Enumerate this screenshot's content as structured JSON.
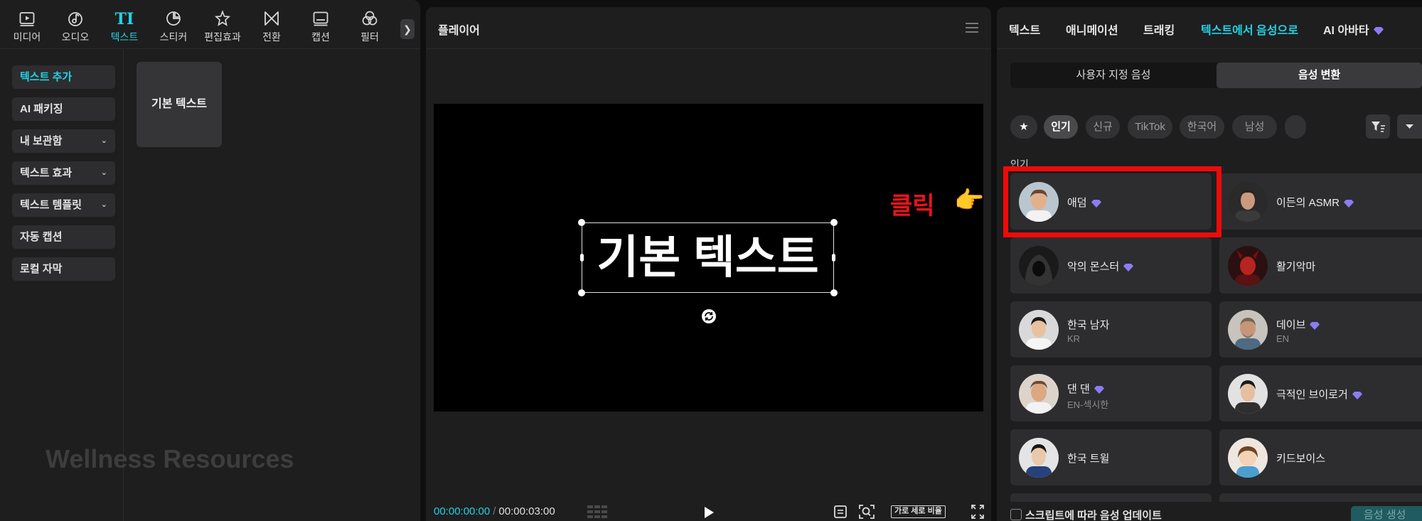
{
  "toolbar": {
    "items": [
      {
        "label": "미디어",
        "icon": "media-icon"
      },
      {
        "label": "오디오",
        "icon": "audio-icon"
      },
      {
        "label": "텍스트",
        "icon": "text-icon",
        "glyph": "TI"
      },
      {
        "label": "스티커",
        "icon": "sticker-icon"
      },
      {
        "label": "편집효과",
        "icon": "effects-icon"
      },
      {
        "label": "전환",
        "icon": "transition-icon"
      },
      {
        "label": "캡션",
        "icon": "caption-icon"
      },
      {
        "label": "필터",
        "icon": "filter-icon"
      }
    ],
    "more_glyph": "❯"
  },
  "sidebar": {
    "items": [
      {
        "label": "텍스트 추가"
      },
      {
        "label": "AI 패키징"
      },
      {
        "label": "내 보관함",
        "chevron": "⌄"
      },
      {
        "label": "텍스트 효과",
        "chevron": "⌄"
      },
      {
        "label": "텍스트 템플릿",
        "chevron": "⌄"
      },
      {
        "label": "자동 캡션"
      },
      {
        "label": "로컬 자막"
      }
    ]
  },
  "content": {
    "card_label": "기본 텍스트"
  },
  "watermark": "Wellness Resources",
  "player": {
    "title": "플레이어",
    "canvas_text": "기본 텍스트",
    "time_current": "00:00:00:00",
    "time_separator": "/",
    "time_total": "00:00:03:00",
    "ratio_label": "가로 세로 비율"
  },
  "annotation": {
    "text": "클릭",
    "hand": "👉"
  },
  "right": {
    "tabs": [
      {
        "label": "텍스트"
      },
      {
        "label": "애니메이션"
      },
      {
        "label": "트래킹"
      },
      {
        "label": "텍스트에서 음성으로"
      },
      {
        "label": "AI 아바타"
      }
    ],
    "segments": [
      {
        "label": "사용자 지정 음성"
      },
      {
        "label": "음성 변환"
      }
    ],
    "filters": [
      {
        "label": "★"
      },
      {
        "label": "인기"
      },
      {
        "label": "신규"
      },
      {
        "label": "TikTok"
      },
      {
        "label": "한국어"
      },
      {
        "label": "남성"
      }
    ],
    "section_label": "인기",
    "voices": [
      {
        "name": "애덤",
        "sub": ""
      },
      {
        "name": "이든의 ASMR",
        "sub": ""
      },
      {
        "name": "악의 몬스터",
        "sub": ""
      },
      {
        "name": "활기악마",
        "sub": ""
      },
      {
        "name": "한국 남자",
        "sub": "KR"
      },
      {
        "name": "데이브",
        "sub": "EN"
      },
      {
        "name": "댄 댄",
        "sub": "EN-섹시한"
      },
      {
        "name": "극적인 브이로거",
        "sub": ""
      },
      {
        "name": "한국 트윌",
        "sub": ""
      },
      {
        "name": "키드보이스",
        "sub": ""
      }
    ],
    "bottom_checkbox_label": "스크립트에 따라 음성 업데이트",
    "generate_label": "음성 생성"
  },
  "colors": {
    "accent": "#22d3e6",
    "annotation_red": "#f00a0a",
    "premium_gem": "#8b7cf6"
  }
}
